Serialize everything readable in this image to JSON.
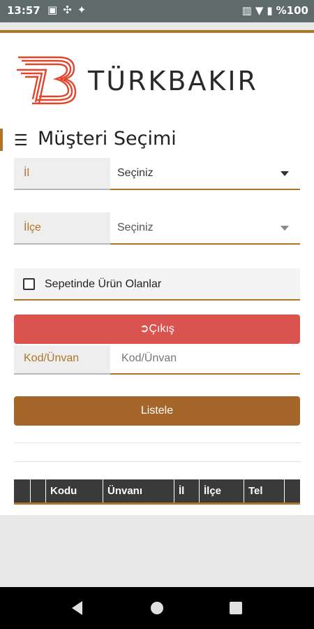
{
  "status_bar": {
    "time": "13:57",
    "icons": [
      "image-icon",
      "fan-icon",
      "sparkle-icon"
    ],
    "right_icons": [
      "barcode-icon",
      "wifi-icon",
      "battery-icon"
    ],
    "battery": "%100"
  },
  "brand": {
    "name": "TÜRKBAKIR",
    "logo": "tb-logo-icon",
    "accent_color": "#b0742a"
  },
  "page": {
    "title": "Müşteri Seçimi",
    "title_icon": "list-icon"
  },
  "form": {
    "il": {
      "label": "İl",
      "value": "Seçiniz"
    },
    "ilce": {
      "label": "İlçe",
      "value": "Seçiniz"
    },
    "basket_checkbox": {
      "label": "Sepetinde Ürün Olanlar",
      "checked": false
    },
    "exit_button": {
      "label": "Çıkış",
      "icon": "sign-out-icon",
      "color": "#d9534f"
    },
    "kod": {
      "label": "Kod/Ünvan",
      "placeholder": "Kod/Ünvan"
    },
    "list_button": {
      "label": "Listele",
      "color": "#a5662a"
    }
  },
  "table": {
    "columns": [
      "",
      "",
      "Kodu",
      "Ünvanı",
      "İl",
      "İlçe",
      "Tel",
      ""
    ]
  },
  "nav": {
    "icons": [
      "back-icon",
      "home-icon",
      "recents-icon"
    ]
  }
}
